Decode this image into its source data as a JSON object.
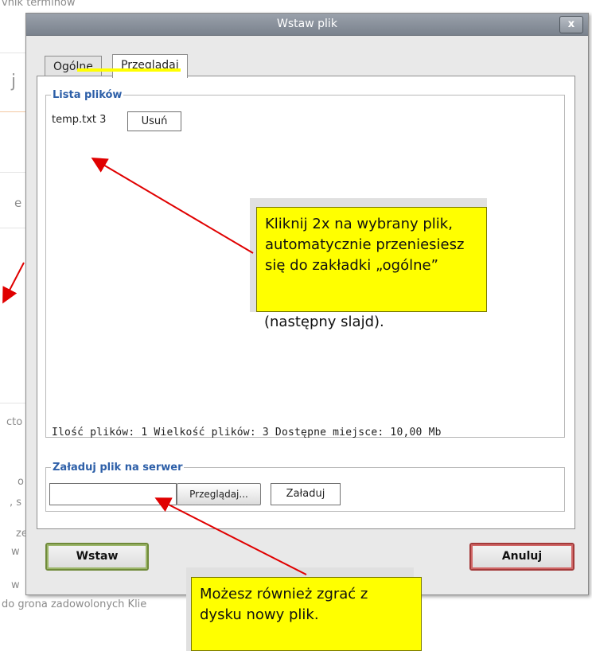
{
  "background": {
    "fragments": [
      "vnik terminów",
      "j",
      "e",
      "cto",
      "o",
      ", s",
      "ze",
      "w",
      "w",
      "do grona zadowolonych Klie"
    ]
  },
  "dialog": {
    "title": "Wstaw plik",
    "close_label": "x",
    "tabs": [
      {
        "label": "Ogólne",
        "active": false
      },
      {
        "label": "Przeglądaj",
        "active": true
      }
    ],
    "file_list": {
      "legend": "Lista plików",
      "items": [
        {
          "name": "temp.txt 3",
          "delete_label": "Usuń"
        }
      ],
      "status": "Ilość plików: 1 Wielkość plików: 3 Dostępne miejsce: 10,00 Mb"
    },
    "upload": {
      "legend": "Załaduj plik na serwer",
      "file_value": "",
      "browse_label": "Przeglądaj...",
      "upload_label": "Załaduj"
    },
    "insert_label": "Wstaw",
    "cancel_label": "Anuluj"
  },
  "callouts": [
    {
      "text": "Kliknij 2x na wybrany plik, automatycznie przeniesiesz się do zakładki „ogólne”",
      "extra": "(następny slajd)."
    },
    {
      "text": "Możesz również zgrać z dysku nowy plik."
    }
  ],
  "colors": {
    "callout": "#ffff00",
    "arrow": "#e00000",
    "legend": "#2d5fa8",
    "tab_highlight": "#ffff00"
  }
}
